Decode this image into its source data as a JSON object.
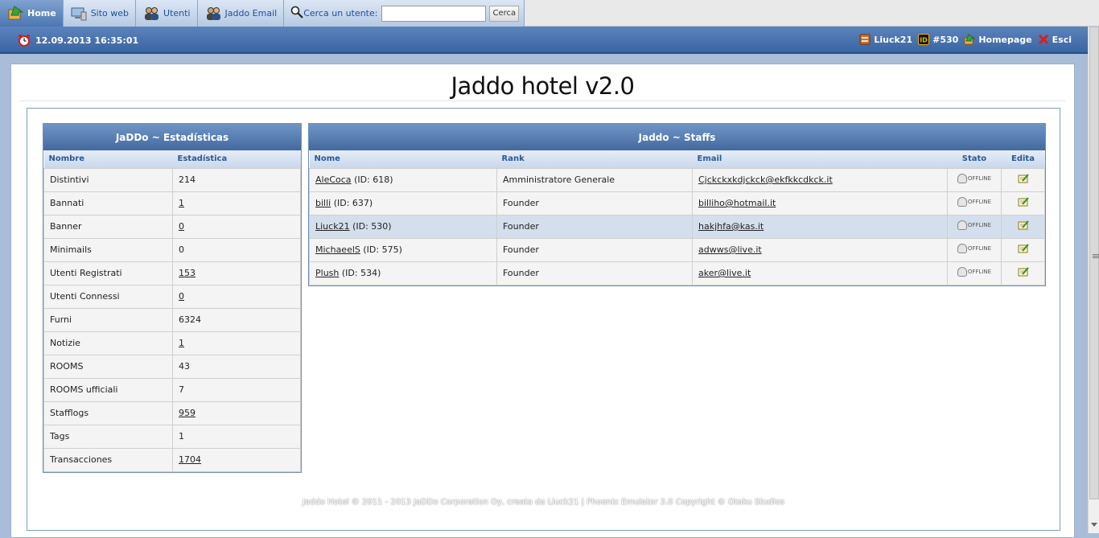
{
  "nav": {
    "tabs": [
      {
        "label": "Home",
        "icon": "home-icon",
        "active": true
      },
      {
        "label": "Sito web",
        "icon": "computer-icon",
        "active": false
      },
      {
        "label": "Utenti",
        "icon": "users-icon",
        "active": false
      },
      {
        "label": "Jaddo Email",
        "icon": "users-email-icon",
        "active": false
      }
    ],
    "search": {
      "label": "Cerca un utente:",
      "value": "",
      "button": "Cerca"
    }
  },
  "infobar": {
    "datetime": "12.09.2013 16:35:01",
    "username": "Liuck21",
    "user_id": "#530",
    "homepage": "Homepage",
    "logout": "Esci"
  },
  "page": {
    "title": "Jaddo hotel v2.0"
  },
  "stats": {
    "title": "JaDDo ~ Estadísticas",
    "columns": [
      "Nombre",
      "Estadística"
    ],
    "rows": [
      {
        "name": "Distintivi",
        "value": "214",
        "link": false
      },
      {
        "name": "Bannati",
        "value": "1",
        "link": true
      },
      {
        "name": "Banner",
        "value": "0",
        "link": true
      },
      {
        "name": "Minimails",
        "value": "0",
        "link": false
      },
      {
        "name": "Utenti Registrati",
        "value": "153",
        "link": true
      },
      {
        "name": "Utenti Connessi",
        "value": "0",
        "link": true
      },
      {
        "name": "Furni",
        "value": "6324",
        "link": false
      },
      {
        "name": "Notizie",
        "value": "1",
        "link": true
      },
      {
        "name": "ROOMS",
        "value": "43",
        "link": false
      },
      {
        "name": "ROOMS ufficiali",
        "value": "7",
        "link": false
      },
      {
        "name": "Stafflogs",
        "value": "959",
        "link": true
      },
      {
        "name": "Tags",
        "value": "1",
        "link": false
      },
      {
        "name": "Transacciones",
        "value": "1704",
        "link": true
      }
    ]
  },
  "staffs": {
    "title": "Jaddo ~ Staffs",
    "columns": [
      "Nome",
      "Rank",
      "Email",
      "Stato",
      "Edita"
    ],
    "status_text": "OFFLINE",
    "rows": [
      {
        "name": "AleCoca",
        "id": "(ID: 618)",
        "rank": "Amministratore Generale",
        "email": "Cjckckxkdjckck@ekfkkcdkck.it",
        "highlight": false
      },
      {
        "name": "billi",
        "id": "(ID: 637)",
        "rank": "Founder",
        "email": "billiho@hotmail.it",
        "highlight": false
      },
      {
        "name": "Liuck21",
        "id": "(ID: 530)",
        "rank": "Founder",
        "email": "hakjhfa@kas.it",
        "highlight": true
      },
      {
        "name": "MichaeelS",
        "id": "(ID: 575)",
        "rank": "Founder",
        "email": "adwws@live.it",
        "highlight": false
      },
      {
        "name": "Plush",
        "id": "(ID: 534)",
        "rank": "Founder",
        "email": "aker@live.it",
        "highlight": false
      }
    ]
  },
  "footer": {
    "text": "Jaddo Hotel © 2011 - 2013 JaDDo Corporation Oy, creata da Liuck21 | Phoenix Emulator 3.0 Copyright © Otaku Studios"
  },
  "colors": {
    "accent": "#43699f",
    "tab_active": "#4b77b3",
    "row_highlight": "#d4dfed"
  }
}
